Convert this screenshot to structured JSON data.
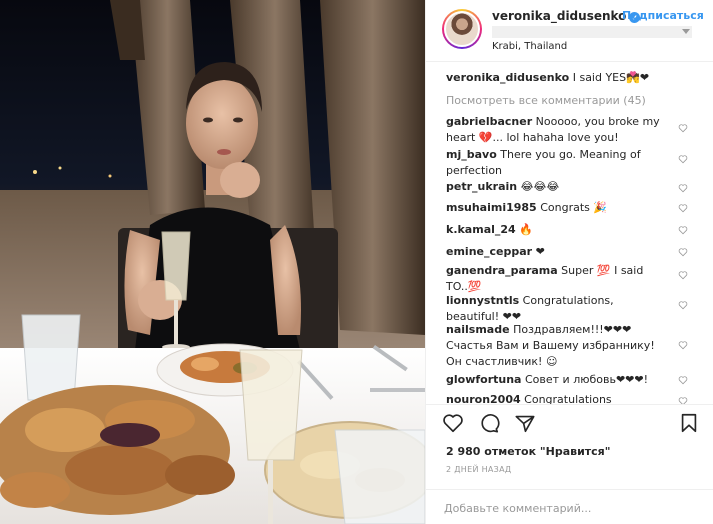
{
  "header": {
    "username": "veronika_didusenko",
    "verified_glyph": "✔",
    "follow_label": "Подписаться",
    "location": "Krabi, Thailand"
  },
  "caption": {
    "username": "veronika_didusenko",
    "text": "I said YES💏❤"
  },
  "view_all_comments": "Посмотреть все комментарии (45)",
  "comments": [
    {
      "username": "gabrielbacner",
      "text": "Nooooo, you broke my heart 💔... lol hahaha love you!"
    },
    {
      "username": "mj_bavo",
      "text": "There you go. Meaning of perfection"
    },
    {
      "username": "petr_ukrain",
      "text": "😂😂😂"
    },
    {
      "username": "msuhaimi1985",
      "text": "Congrats 🎉"
    },
    {
      "username": "k.kamal_24",
      "text": "🔥"
    },
    {
      "username": "emine_ceppar",
      "text": "❤"
    },
    {
      "username": "ganendra_parama",
      "text": "Super 💯 I said TO..💯"
    },
    {
      "username": "lionnystntls",
      "text": "Congratulations, beautiful! ❤❤"
    },
    {
      "username": "nailsmade",
      "text": "Поздравляем!!!❤❤❤ Счастья Вам и Вашему избраннику! Он счастливчик! ☺"
    },
    {
      "username": "glowfortuna",
      "text": "Совет и любовь❤❤❤!"
    },
    {
      "username": "nouron2004",
      "text": "Congratulations"
    }
  ],
  "icons": {
    "like": "heart-icon",
    "comment": "comment-icon",
    "share": "share-icon",
    "save": "bookmark-icon",
    "comment_like": "small-heart-icon"
  },
  "likes_text": "2 980 отметок \"Нравится\"",
  "timestamp": "2 ДНЕЙ НАЗАД",
  "add_comment_placeholder": "Добавьте комментарий...",
  "colors": {
    "link_blue": "#3897f0",
    "text": "#262626",
    "muted": "#999999",
    "verified_blue": "#3897f0"
  }
}
